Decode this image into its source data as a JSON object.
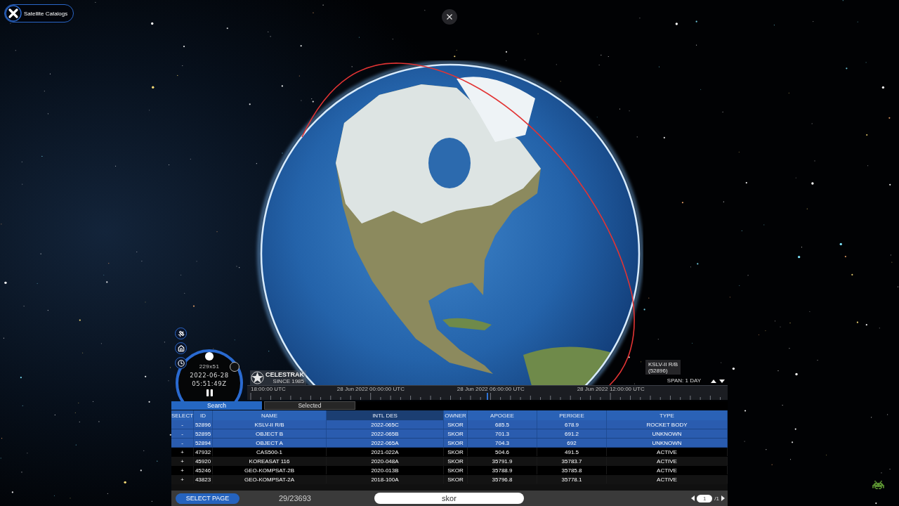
{
  "catalog_button": {
    "label": "Satellite Catalogs"
  },
  "clock": {
    "resolution": "229x51",
    "date": "2022-06-28",
    "time": "05:51:49Z",
    "playing": true
  },
  "logo": {
    "name": "CELESTRAK",
    "tagline": "SINCE 1985"
  },
  "satellite_label": {
    "name": "KSLV-II R/B",
    "id": "(52896)"
  },
  "timeline": {
    "span": "SPAN: 1 DAY",
    "labels": [
      "18:00:00 UTC",
      "28 Jun 2022 00:00:00 UTC",
      "28 Jun 2022 06:00:00 UTC",
      "28 Jun 2022 12:00:00 UTC"
    ],
    "level": 0.5
  },
  "tabs": [
    {
      "label": "Search",
      "selected": true
    },
    {
      "label": "Selected",
      "selected": false
    }
  ],
  "table": {
    "columns": [
      {
        "label": "SELECT",
        "sorted": false
      },
      {
        "label": "ID",
        "sorted": false
      },
      {
        "label": "NAME",
        "sorted": false
      },
      {
        "label": "INTL DES",
        "sorted": true
      },
      {
        "label": "OWNER",
        "sorted": false
      },
      {
        "label": "APOGEE",
        "sorted": false
      },
      {
        "label": "PERIGEE",
        "sorted": false
      },
      {
        "label": "TYPE",
        "sorted": false
      }
    ],
    "rows": [
      {
        "selected": true,
        "cells": [
          "-",
          "52896",
          "KSLV-II R/B",
          "2022-065C",
          "SKOR",
          "685.5",
          "678.9",
          "ROCKET BODY"
        ]
      },
      {
        "selected": true,
        "cells": [
          "-",
          "52895",
          "OBJECT B",
          "2022-065B",
          "SKOR",
          "701.3",
          "691.2",
          "UNKNOWN"
        ]
      },
      {
        "selected": true,
        "cells": [
          "-",
          "52894",
          "OBJECT A",
          "2022-065A",
          "SKOR",
          "704.3",
          "692",
          "UNKNOWN"
        ]
      },
      {
        "selected": false,
        "cells": [
          "+",
          "47932",
          "CAS500-1",
          "2021-022A",
          "SKOR",
          "504.6",
          "491.5",
          "ACTIVE"
        ]
      },
      {
        "selected": false,
        "cells": [
          "+",
          "45920",
          "KOREASAT 116",
          "2020-048A",
          "SKOR",
          "35791.9",
          "35783.7",
          "ACTIVE"
        ]
      },
      {
        "selected": false,
        "cells": [
          "+",
          "45246",
          "GEO-KOMPSAT-2B",
          "2020-013B",
          "SKOR",
          "35788.9",
          "35785.8",
          "ACTIVE"
        ]
      },
      {
        "selected": false,
        "cells": [
          "+",
          "43823",
          "GEO-KOMPSAT-2A",
          "2018-100A",
          "SKOR",
          "35796.8",
          "35778.1",
          "ACTIVE"
        ]
      }
    ]
  },
  "footer": {
    "select_page": "SELECT PAGE",
    "count": "29/23693",
    "search": {
      "value": "skor"
    },
    "page": {
      "value": "1",
      "total": "/1"
    }
  }
}
